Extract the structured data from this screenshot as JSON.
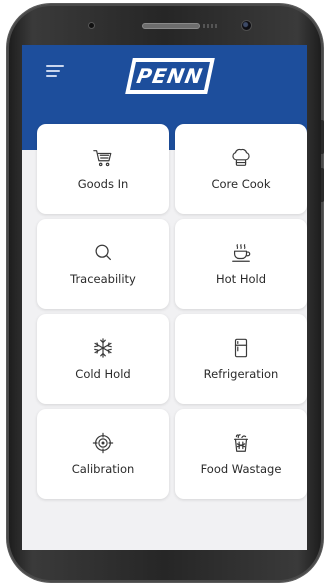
{
  "app": {
    "brand": "PENN",
    "colors": {
      "primary": "#1d4e9c",
      "background": "#f1f1f3",
      "tile": "#ffffff"
    }
  },
  "header": {
    "menu_icon": "hamburger-menu-icon",
    "logo_text": "PENN"
  },
  "tiles": [
    {
      "label": "Goods In",
      "icon": "cart-icon"
    },
    {
      "label": "Core Cook",
      "icon": "chef-hat-icon"
    },
    {
      "label": "Traceability",
      "icon": "search-icon"
    },
    {
      "label": "Hot Hold",
      "icon": "hot-cup-icon"
    },
    {
      "label": "Cold Hold",
      "icon": "snowflake-icon"
    },
    {
      "label": "Refrigeration",
      "icon": "fridge-icon"
    },
    {
      "label": "Calibration",
      "icon": "target-icon"
    },
    {
      "label": "Food Wastage",
      "icon": "bin-icon"
    }
  ]
}
